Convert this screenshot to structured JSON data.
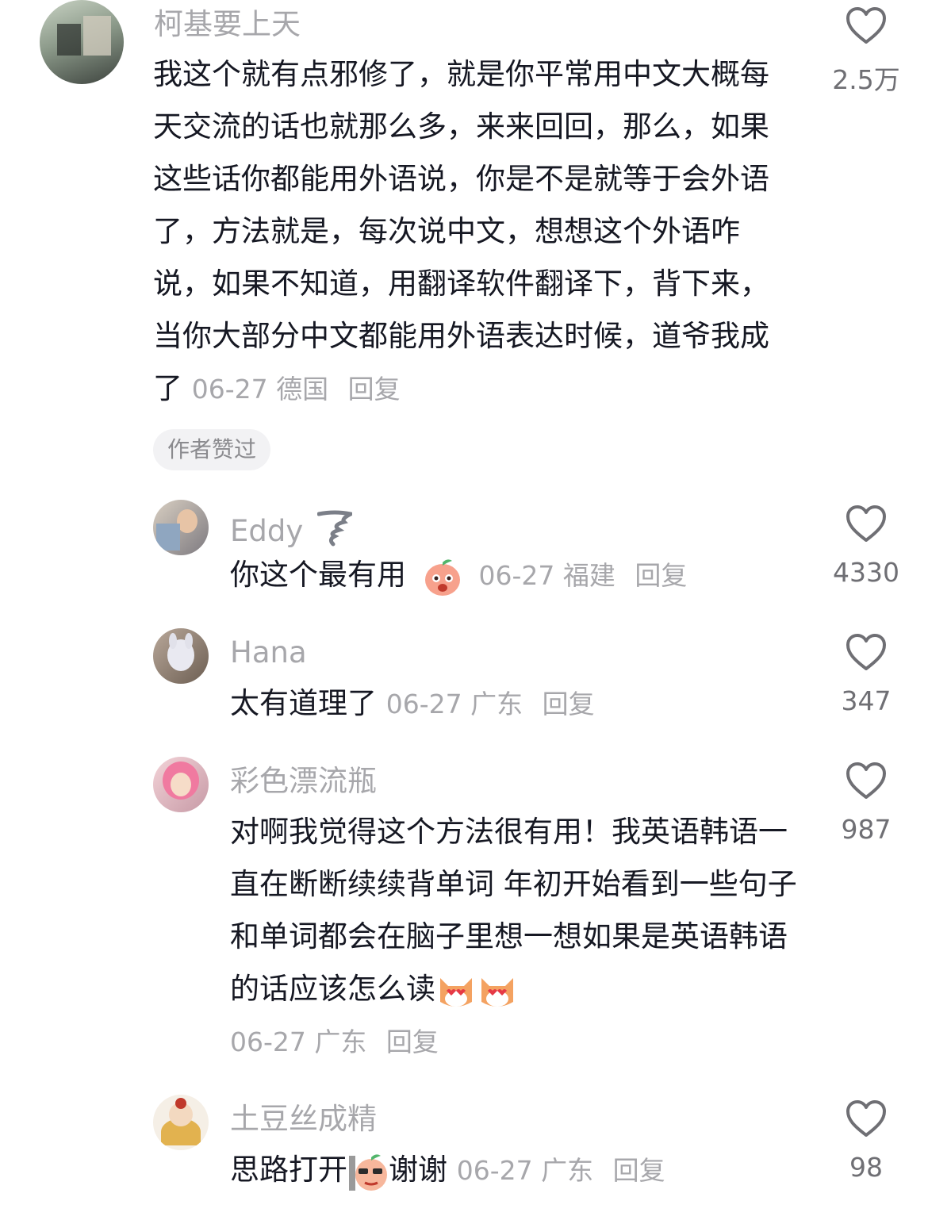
{
  "comments": [
    {
      "username": "柯基要上天",
      "text": "我这个就有点邪修了，就是你平常用中文大概每天交流的话也就那么多，来来回回，那么，如果这些话你都能用外语说，你是不是就等于会外语了，方法就是，每次说中文，想想这个外语咋说，如果不知道，用翻译软件翻译下，背下来，当你大部分中文都能用外语表达时候，道爷我成了",
      "date": "06-27",
      "location": "德国",
      "reply_label": "回复",
      "badge": "作者赞过",
      "likes": "2.5万"
    },
    {
      "username": "Eddy",
      "username_emoji": "tornado-emoji",
      "text": "你这个最有用",
      "text_emoji": "peach-face-emoji",
      "date": "06-27",
      "location": "福建",
      "reply_label": "回复",
      "likes": "4330"
    },
    {
      "username": "Hana",
      "text": "太有道理了",
      "date": "06-27",
      "location": "广东",
      "reply_label": "回复",
      "likes": "347"
    },
    {
      "username": "彩色漂流瓶",
      "text": "对啊我觉得这个方法很有用！我英语韩语一直在断断续续背单词 年初开始看到一些句子和单词都会在脑子里想一想如果是英语韩语的话应该怎么读",
      "text_emoji": "heart-eyes-dog-emoji x2",
      "date": "06-27",
      "location": "广东",
      "reply_label": "回复",
      "likes": "987"
    },
    {
      "username": "土豆丝成精",
      "text_before": "思路打开",
      "text_after": "谢谢",
      "text_emoji": "peach-sunglasses-emoji",
      "date": "06-27",
      "location": "广东",
      "reply_label": "回复",
      "likes": "98"
    }
  ],
  "colors": {
    "text": "#161823",
    "secondary": "#a7a7ab",
    "badge_bg": "#f2f2f4"
  },
  "icons": [
    "heart-outline-icon"
  ]
}
